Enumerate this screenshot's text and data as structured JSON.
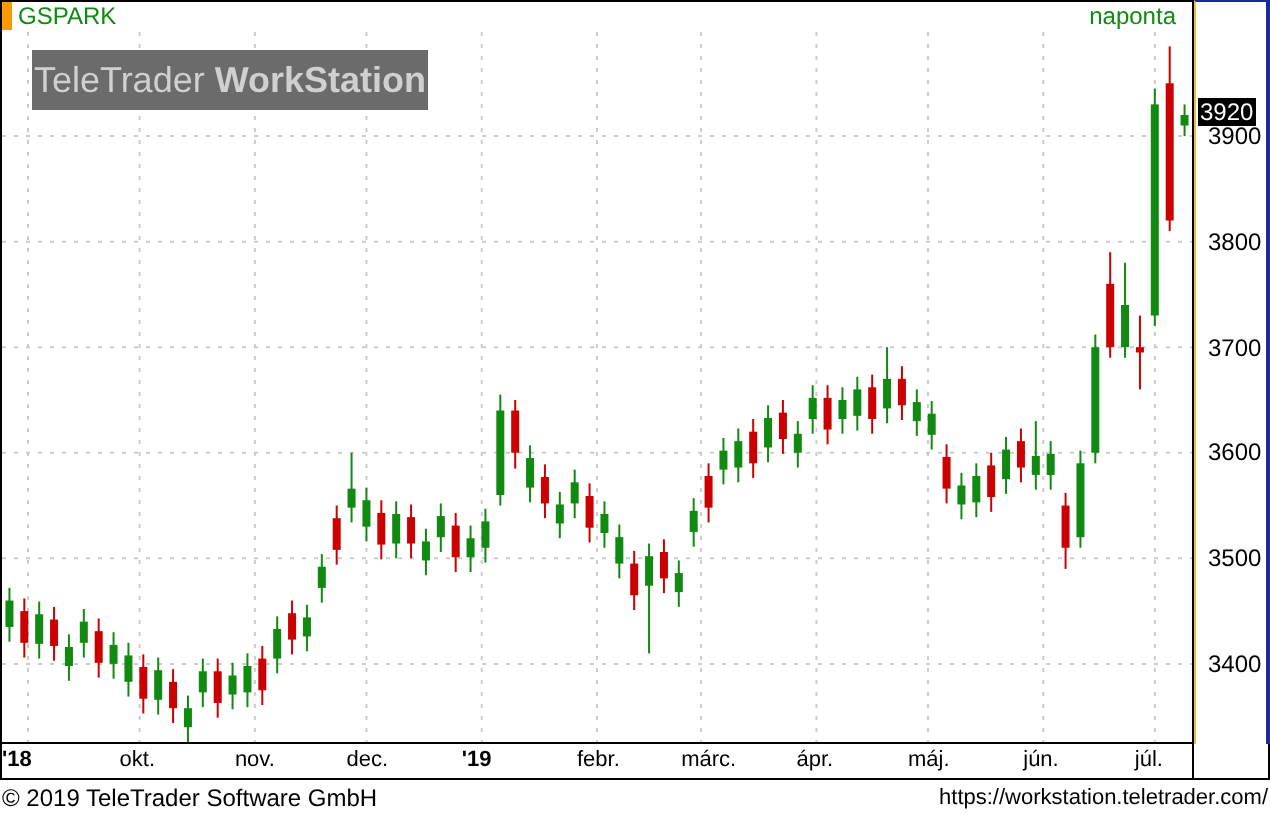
{
  "chart": {
    "symbol": "GSPARK",
    "period": "naponta",
    "logo": "TeleTrader **WorkStation**",
    "last_price": "3920",
    "chart_data": {
      "type": "candlestick",
      "x": [
        "2018-08-27",
        "2018-08-31",
        "2018-09-04",
        "2018-09-08",
        "2018-09-12",
        "2018-09-16",
        "2018-09-20",
        "2018-09-24",
        "2018-09-28",
        "2018-10-02",
        "2018-10-06",
        "2018-10-10",
        "2018-10-14",
        "2018-10-18",
        "2018-10-22",
        "2018-10-26",
        "2018-10-30",
        "2018-11-03",
        "2018-11-07",
        "2018-11-11",
        "2018-11-15",
        "2018-11-19",
        "2018-11-23",
        "2018-11-27",
        "2018-12-01",
        "2018-12-05",
        "2018-12-09",
        "2018-12-13",
        "2018-12-17",
        "2018-12-21",
        "2018-12-25",
        "2018-12-29",
        "2019-01-02",
        "2019-01-06",
        "2019-01-10",
        "2019-01-14",
        "2019-01-18",
        "2019-01-22",
        "2019-01-26",
        "2019-01-30",
        "2019-02-03",
        "2019-02-07",
        "2019-02-11",
        "2019-02-15",
        "2019-02-19",
        "2019-02-23",
        "2019-02-27",
        "2019-03-03",
        "2019-03-07",
        "2019-03-11",
        "2019-03-15",
        "2019-03-19",
        "2019-03-23",
        "2019-03-27",
        "2019-03-31",
        "2019-04-04",
        "2019-04-08",
        "2019-04-12",
        "2019-04-16",
        "2019-04-20",
        "2019-04-24",
        "2019-04-28",
        "2019-05-02",
        "2019-05-06",
        "2019-05-10",
        "2019-05-14",
        "2019-05-18",
        "2019-05-22",
        "2019-05-26",
        "2019-05-30",
        "2019-06-03",
        "2019-06-07",
        "2019-06-11",
        "2019-06-15",
        "2019-06-19",
        "2019-06-23",
        "2019-06-27",
        "2019-07-01",
        "2019-07-05",
        "2019-07-09"
      ],
      "ohlc": [
        [
          3435,
          3472,
          3421,
          3460
        ],
        [
          3450,
          3462,
          3406,
          3420
        ],
        [
          3419,
          3459,
          3405,
          3447
        ],
        [
          3442,
          3454,
          3403,
          3417
        ],
        [
          3398,
          3428,
          3384,
          3416
        ],
        [
          3420,
          3452,
          3406,
          3440
        ],
        [
          3431,
          3443,
          3387,
          3401
        ],
        [
          3400,
          3430,
          3386,
          3418
        ],
        [
          3383,
          3420,
          3369,
          3408
        ],
        [
          3397,
          3409,
          3353,
          3367
        ],
        [
          3366,
          3406,
          3352,
          3394
        ],
        [
          3383,
          3395,
          3344,
          3358
        ],
        [
          3340,
          3370,
          3326,
          3358
        ],
        [
          3373,
          3405,
          3359,
          3393
        ],
        [
          3393,
          3405,
          3349,
          3363
        ],
        [
          3371,
          3401,
          3357,
          3389
        ],
        [
          3373,
          3410,
          3359,
          3398
        ],
        [
          3405,
          3417,
          3361,
          3375
        ],
        [
          3405,
          3445,
          3391,
          3433
        ],
        [
          3448,
          3460,
          3409,
          3423
        ],
        [
          3426,
          3456,
          3412,
          3444
        ],
        [
          3472,
          3504,
          3458,
          3492
        ],
        [
          3538,
          3550,
          3494,
          3508
        ],
        [
          3548,
          3600,
          3534,
          3566
        ],
        [
          3530,
          3567,
          3516,
          3555
        ],
        [
          3543,
          3555,
          3499,
          3513
        ],
        [
          3514,
          3554,
          3500,
          3542
        ],
        [
          3539,
          3551,
          3500,
          3514
        ],
        [
          3498,
          3528,
          3484,
          3516
        ],
        [
          3520,
          3552,
          3506,
          3540
        ],
        [
          3531,
          3543,
          3487,
          3501
        ],
        [
          3501,
          3531,
          3487,
          3519
        ],
        [
          3510,
          3547,
          3496,
          3535
        ],
        [
          3560,
          3655,
          3550,
          3640
        ],
        [
          3640,
          3650,
          3585,
          3600
        ],
        [
          3567,
          3607,
          3553,
          3595
        ],
        [
          3577,
          3589,
          3538,
          3552
        ],
        [
          3533,
          3563,
          3519,
          3551
        ],
        [
          3552,
          3584,
          3538,
          3572
        ],
        [
          3559,
          3571,
          3515,
          3529
        ],
        [
          3524,
          3554,
          3510,
          3542
        ],
        [
          3495,
          3532,
          3481,
          3520
        ],
        [
          3495,
          3507,
          3451,
          3465
        ],
        [
          3474,
          3514,
          3410,
          3502
        ],
        [
          3506,
          3518,
          3467,
          3481
        ],
        [
          3468,
          3498,
          3454,
          3486
        ],
        [
          3525,
          3557,
          3511,
          3545
        ],
        [
          3578,
          3590,
          3534,
          3548
        ],
        [
          3584,
          3614,
          3570,
          3602
        ],
        [
          3586,
          3623,
          3572,
          3611
        ],
        [
          3620,
          3632,
          3576,
          3590
        ],
        [
          3605,
          3645,
          3591,
          3633
        ],
        [
          3638,
          3650,
          3599,
          3613
        ],
        [
          3600,
          3630,
          3586,
          3618
        ],
        [
          3632,
          3664,
          3618,
          3652
        ],
        [
          3652,
          3664,
          3608,
          3622
        ],
        [
          3632,
          3662,
          3618,
          3650
        ],
        [
          3635,
          3672,
          3621,
          3660
        ],
        [
          3662,
          3674,
          3618,
          3632
        ],
        [
          3642,
          3700,
          3628,
          3670
        ],
        [
          3670,
          3682,
          3631,
          3645
        ],
        [
          3630,
          3660,
          3616,
          3648
        ],
        [
          3617,
          3649,
          3603,
          3637
        ],
        [
          3596,
          3608,
          3552,
          3566
        ],
        [
          3551,
          3581,
          3537,
          3569
        ],
        [
          3553,
          3590,
          3539,
          3578
        ],
        [
          3588,
          3600,
          3544,
          3558
        ],
        [
          3575,
          3615,
          3561,
          3603
        ],
        [
          3611,
          3623,
          3572,
          3586
        ],
        [
          3579,
          3630,
          3565,
          3597
        ],
        [
          3579,
          3611,
          3565,
          3599
        ],
        [
          3550,
          3562,
          3490,
          3510
        ],
        [
          3520,
          3602,
          3510,
          3590
        ],
        [
          3600,
          3712,
          3590,
          3700
        ],
        [
          3760,
          3790,
          3690,
          3700
        ],
        [
          3700,
          3780,
          3690,
          3740
        ],
        [
          3700,
          3730,
          3660,
          3695
        ],
        [
          3730,
          3945,
          3720,
          3930
        ],
        [
          3950,
          3985,
          3810,
          3820
        ],
        [
          3910,
          3930,
          3900,
          3920
        ]
      ],
      "grid": true,
      "xlim": [
        "2018-08-25",
        "2019-07-11"
      ],
      "ylim": [
        3326,
        4027
      ],
      "yticks": [
        3400,
        3500,
        3600,
        3700,
        3800,
        3900
      ],
      "xticks": [
        {
          "value": "2018-09-01",
          "label": "'18"
        },
        {
          "value": "2018-10-01",
          "label": "okt."
        },
        {
          "value": "2018-11-01",
          "label": "nov."
        },
        {
          "value": "2018-12-01",
          "label": "dec."
        },
        {
          "value": "2019-01-01",
          "label": "'19"
        },
        {
          "value": "2019-02-01",
          "label": "febr."
        },
        {
          "value": "2019-03-01",
          "label": "márc."
        },
        {
          "value": "2019-04-01",
          "label": "ápr."
        },
        {
          "value": "2019-05-01",
          "label": "máj."
        },
        {
          "value": "2019-06-01",
          "label": "jún."
        },
        {
          "value": "2019-07-01",
          "label": "júl."
        }
      ]
    }
  },
  "footer": {
    "copyright": "© 2019 TeleTrader Software GmbH",
    "url": "https://workstation.teletrader.com/"
  }
}
